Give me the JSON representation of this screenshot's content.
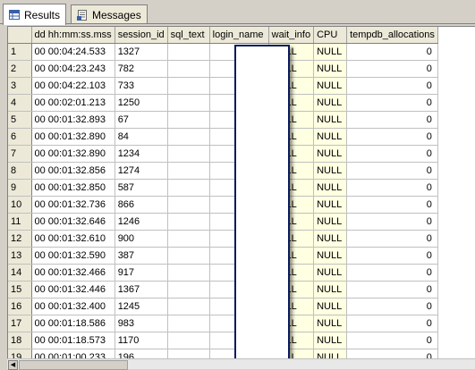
{
  "tabs": [
    {
      "label": "Results",
      "icon": "grid-icon"
    },
    {
      "label": "Messages",
      "icon": "messages-icon"
    }
  ],
  "columns": [
    "dd hh:mm:ss.mss",
    "session_id",
    "sql_text",
    "login_name",
    "wait_info",
    "CPU",
    "tempdb_allocations"
  ],
  "rows": [
    {
      "n": "1",
      "dd": "00 00:04:24.533",
      "sid": "1327",
      "wait": "NULL",
      "cpu": "NULL",
      "temp": "0"
    },
    {
      "n": "2",
      "dd": "00 00:04:23.243",
      "sid": "782",
      "wait": "NULL",
      "cpu": "NULL",
      "temp": "0"
    },
    {
      "n": "3",
      "dd": "00 00:04:22.103",
      "sid": "733",
      "wait": "NULL",
      "cpu": "NULL",
      "temp": "0"
    },
    {
      "n": "4",
      "dd": "00 00:02:01.213",
      "sid": "1250",
      "wait": "NULL",
      "cpu": "NULL",
      "temp": "0"
    },
    {
      "n": "5",
      "dd": "00 00:01:32.893",
      "sid": "67",
      "wait": "NULL",
      "cpu": "NULL",
      "temp": "0"
    },
    {
      "n": "6",
      "dd": "00 00:01:32.890",
      "sid": "84",
      "wait": "NULL",
      "cpu": "NULL",
      "temp": "0"
    },
    {
      "n": "7",
      "dd": "00 00:01:32.890",
      "sid": "1234",
      "wait": "NULL",
      "cpu": "NULL",
      "temp": "0"
    },
    {
      "n": "8",
      "dd": "00 00:01:32.856",
      "sid": "1274",
      "wait": "NULL",
      "cpu": "NULL",
      "temp": "0"
    },
    {
      "n": "9",
      "dd": "00 00:01:32.850",
      "sid": "587",
      "wait": "NULL",
      "cpu": "NULL",
      "temp": "0"
    },
    {
      "n": "10",
      "dd": "00 00:01:32.736",
      "sid": "866",
      "wait": "NULL",
      "cpu": "NULL",
      "temp": "0"
    },
    {
      "n": "11",
      "dd": "00 00:01:32.646",
      "sid": "1246",
      "wait": "NULL",
      "cpu": "NULL",
      "temp": "0"
    },
    {
      "n": "12",
      "dd": "00 00:01:32.610",
      "sid": "900",
      "wait": "NULL",
      "cpu": "NULL",
      "temp": "0"
    },
    {
      "n": "13",
      "dd": "00 00:01:32.590",
      "sid": "387",
      "wait": "NULL",
      "cpu": "NULL",
      "temp": "0"
    },
    {
      "n": "14",
      "dd": "00 00:01:32.466",
      "sid": "917",
      "wait": "NULL",
      "cpu": "NULL",
      "temp": "0"
    },
    {
      "n": "15",
      "dd": "00 00:01:32.446",
      "sid": "1367",
      "wait": "NULL",
      "cpu": "NULL",
      "temp": "0"
    },
    {
      "n": "16",
      "dd": "00 00:01:32.400",
      "sid": "1245",
      "wait": "NULL",
      "cpu": "NULL",
      "temp": "0"
    },
    {
      "n": "17",
      "dd": "00 00:01:18.586",
      "sid": "983",
      "wait": "NULL",
      "cpu": "NULL",
      "temp": "0"
    },
    {
      "n": "18",
      "dd": "00 00:01:18.573",
      "sid": "1170",
      "wait": "NULL",
      "cpu": "NULL",
      "temp": "0"
    },
    {
      "n": "19",
      "dd": "00 00:01:00.233",
      "sid": "196",
      "wait": "NULL",
      "cpu": "NULL",
      "temp": "0"
    }
  ]
}
